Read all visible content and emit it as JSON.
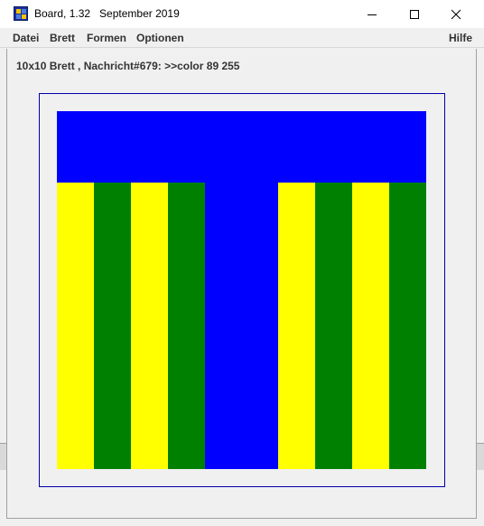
{
  "window": {
    "title": "Board, 1.32   September 2019",
    "controls": {
      "minimize_icon": "minimize-icon",
      "maximize_icon": "maximize-icon",
      "close_icon": "close-icon"
    }
  },
  "menubar": {
    "items": [
      "Datei",
      "Brett",
      "Formen",
      "Optionen"
    ],
    "help": "Hilfe"
  },
  "status": {
    "text": "10x10 Brett , Nachricht#679: >>color 89 255"
  },
  "board": {
    "rows": 10,
    "cols": 10,
    "frame_color": "#0000aa",
    "colors": {
      "B": "#0000ff",
      "Y": "#ffff00",
      "G": "#008000"
    },
    "grid": [
      "BBBBBBBBBB",
      "BBBBBBBBBB",
      "YGYGBBYGYG",
      "YGYGBBYGYG",
      "YGYGBBYGYG",
      "YGYGBBYGYG",
      "YGYGBBYGYG",
      "YGYGBBYGYG",
      "YGYGBBYGYG",
      "YGYGBBYGYG"
    ]
  }
}
